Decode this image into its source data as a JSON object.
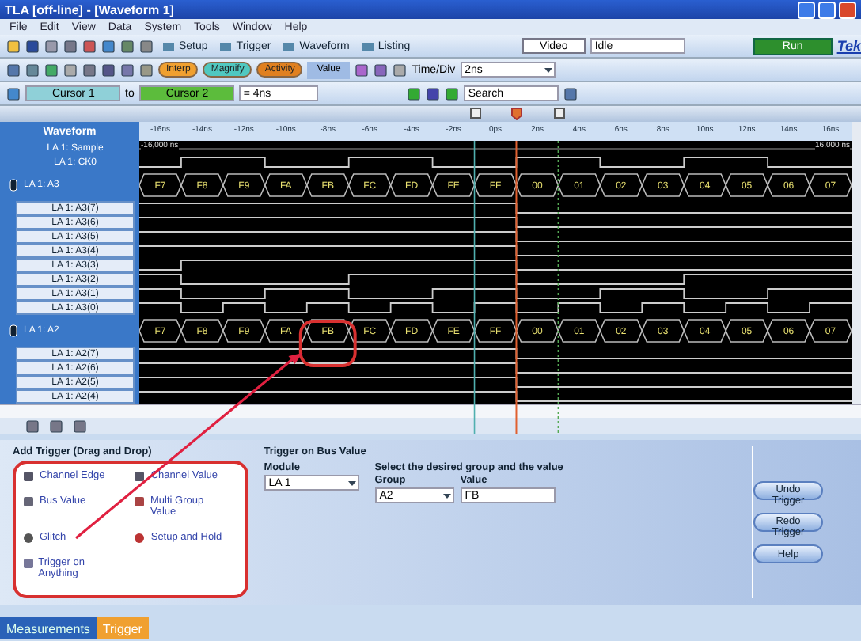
{
  "window": {
    "title": "TLA [off-line] - [Waveform 1]"
  },
  "menu": [
    "File",
    "Edit",
    "View",
    "Data",
    "System",
    "Tools",
    "Window",
    "Help"
  ],
  "toolbar": {
    "buttons": [
      "Setup",
      "Trigger",
      "Waveform",
      "Listing"
    ],
    "video": "Video",
    "status": "Idle",
    "run": "Run",
    "logo": "Tek"
  },
  "toolbar2": {
    "tags": [
      {
        "label": "Interp",
        "color": "#f0a030"
      },
      {
        "label": "Magnify",
        "color": "#50c8c0"
      },
      {
        "label": "Activity",
        "color": "#e08020"
      }
    ],
    "value_button": "Value",
    "time_div_label": "Time/Div",
    "time_div": "2ns"
  },
  "cursor_bar": {
    "cursor1": "Cursor 1",
    "to": "to",
    "cursor2": "Cursor 2",
    "delta": "= 4ns",
    "search": "Search"
  },
  "waveform": {
    "header": "Waveform",
    "left_time": "-16,000 ns",
    "right_time": "16,000 ns",
    "ticks": [
      "-16ns",
      "-14ns",
      "-12ns",
      "-10ns",
      "-8ns",
      "-6ns",
      "-4ns",
      "-2ns",
      "0ps",
      "2ns",
      "4ns",
      "6ns",
      "8ns",
      "10ns",
      "12ns",
      "14ns",
      "16ns"
    ],
    "signals": [
      {
        "kind": "sample",
        "name": "LA 1: Sample"
      },
      {
        "kind": "clock",
        "name": "LA 1: CK0"
      },
      {
        "kind": "bus",
        "name": "LA 1: A3",
        "values": [
          "F7",
          "F8",
          "F9",
          "FA",
          "FB",
          "FC",
          "FD",
          "FE",
          "FF",
          "00",
          "01",
          "02",
          "03",
          "04",
          "05",
          "06",
          "07"
        ],
        "children": [
          {
            "name": "LA 1: A3(7)"
          },
          {
            "name": "LA 1: A3(6)"
          },
          {
            "name": "LA 1: A3(5)"
          },
          {
            "name": "LA 1: A3(4)"
          },
          {
            "name": "LA 1: A3(3)"
          },
          {
            "name": "LA 1: A3(2)"
          },
          {
            "name": "LA 1: A3(1)"
          },
          {
            "name": "LA 1: A3(0)"
          }
        ]
      },
      {
        "kind": "bus",
        "name": "LA 1: A2",
        "values": [
          "F7",
          "F8",
          "F9",
          "FA",
          "FB",
          "FC",
          "FD",
          "FE",
          "FF",
          "00",
          "01",
          "02",
          "03",
          "04",
          "05",
          "06",
          "07"
        ],
        "children": [
          {
            "name": "LA 1: A2(7)"
          },
          {
            "name": "LA 1: A2(6)"
          },
          {
            "name": "LA 1: A2(5)"
          },
          {
            "name": "LA 1: A2(4)"
          }
        ]
      }
    ]
  },
  "trigger": {
    "palette_title": "Add Trigger (Drag and Drop)",
    "items": [
      {
        "kind": "edge",
        "label": "Channel Edge"
      },
      {
        "kind": "value",
        "label": "Channel Value"
      },
      {
        "kind": "bus",
        "label": "Bus Value"
      },
      {
        "kind": "multi",
        "label": "Multi Group Value"
      },
      {
        "kind": "glitch",
        "label": "Glitch"
      },
      {
        "kind": "setup",
        "label": "Setup and Hold"
      },
      {
        "kind": "anything",
        "label": "Trigger on Anything"
      }
    ],
    "title": "Trigger on Bus Value",
    "module_label": "Module",
    "module": "LA 1",
    "instruction": "Select the desired group and the value",
    "group_label": "Group",
    "group": "A2",
    "value_label": "Value",
    "value": "FB",
    "buttons": [
      "Undo Trigger",
      "Redo Trigger",
      "Help"
    ]
  },
  "tabs": [
    {
      "label": "Measurements",
      "selected": false
    },
    {
      "label": "Trigger",
      "selected": true
    }
  ]
}
